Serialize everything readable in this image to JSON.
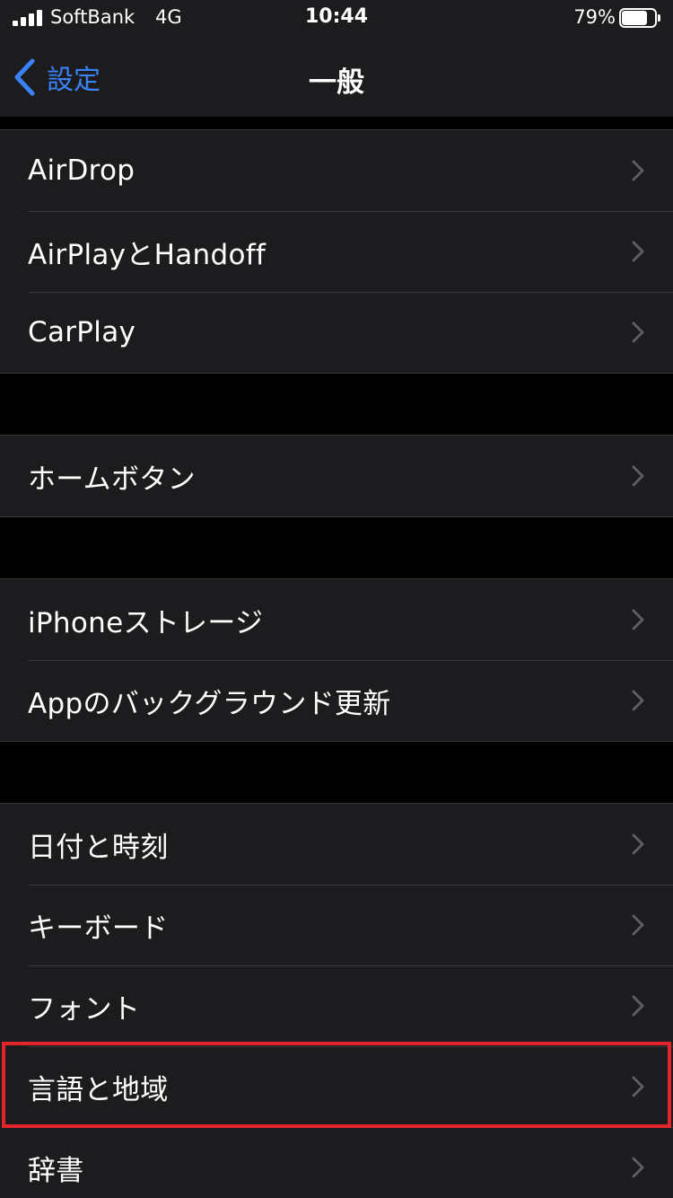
{
  "status_bar": {
    "carrier": "SoftBank",
    "network": "4G",
    "time": "10:44",
    "battery_percent": "79%",
    "battery_level": 0.79
  },
  "nav": {
    "back_label": "設定",
    "title": "一般"
  },
  "groups": [
    {
      "items": [
        {
          "label": "AirDrop"
        },
        {
          "label": "AirPlayとHandoff"
        },
        {
          "label": "CarPlay"
        }
      ]
    },
    {
      "items": [
        {
          "label": "ホームボタン"
        }
      ]
    },
    {
      "items": [
        {
          "label": "iPhoneストレージ"
        },
        {
          "label": "Appのバックグラウンド更新"
        }
      ]
    },
    {
      "items": [
        {
          "label": "日付と時刻"
        },
        {
          "label": "キーボード"
        },
        {
          "label": "フォント"
        },
        {
          "label": "言語と地域"
        },
        {
          "label": "辞書"
        }
      ]
    }
  ],
  "highlighted_item": "言語と地域",
  "colors": {
    "background": "#000000",
    "cell": "#1c1c1e",
    "accent": "#3a82f7",
    "highlight": "#e5232c"
  }
}
